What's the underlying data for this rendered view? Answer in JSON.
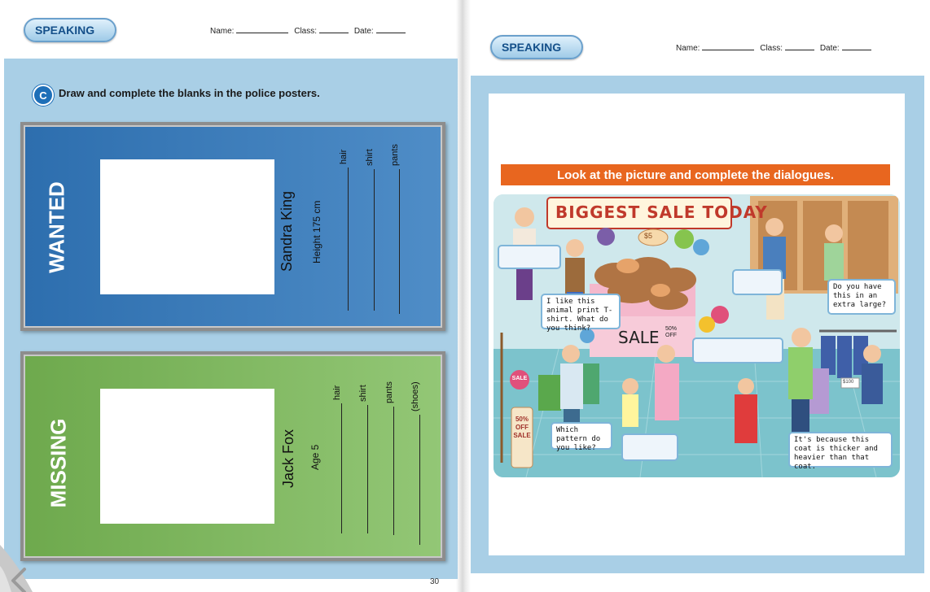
{
  "left_page": {
    "header": {
      "badge": "SPEAKING",
      "name_label": "Name:",
      "class_label": "Class:",
      "date_label": "Date:"
    },
    "section_letter": "C",
    "instruction": "Draw and complete the blanks in the police posters.",
    "wanted_poster": {
      "title": "WANTED",
      "person_name": "Sandra King",
      "detail": "Height 175 cm",
      "fields": [
        "hair",
        "shirt",
        "pants"
      ]
    },
    "missing_poster": {
      "title": "MISSING",
      "person_name": "Jack Fox",
      "detail": "Age 5",
      "fields": [
        "hair",
        "shirt",
        "pants",
        "(shoes)"
      ]
    },
    "page_number": "30"
  },
  "right_page": {
    "header": {
      "badge": "SPEAKING",
      "name_label": "Name:",
      "class_label": "Class:",
      "date_label": "Date:"
    },
    "instruction": "Look at the picture and complete the dialogues.",
    "scene": {
      "banner": "BIGGEST SALE TODAY",
      "price_tag": "$5",
      "sale_sign": "SALE",
      "discount": "50% OFF",
      "side_sale": "SALE",
      "vertical_sign": "50% OFF SALE",
      "price_small": "$100",
      "bubbles": [
        "I like this animal print T-shirt. What do you think?",
        "Do you have this in an extra large?",
        "Which pattern do you like?",
        "It's because this coat is thicker and heavier than that coat."
      ]
    }
  },
  "colors": {
    "panel_blue": "#a9cfe6",
    "wanted_blue": "#2d6eae",
    "missing_green": "#7ab35b",
    "orange_bar": "#e8661f",
    "badge_blue": "#1e6fb8"
  }
}
